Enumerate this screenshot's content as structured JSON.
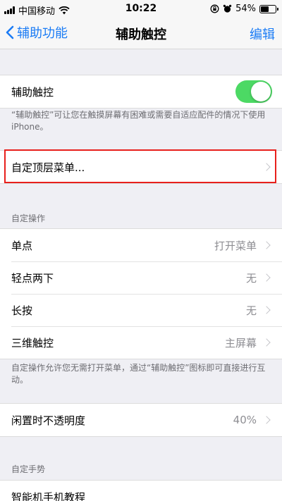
{
  "status_bar": {
    "carrier": "中国移动",
    "time": "10:22",
    "battery": "54%",
    "battery_level": 0.54
  },
  "nav": {
    "back_label": "辅助功能",
    "title": "辅助触控",
    "edit_label": "编辑"
  },
  "assistive_touch": {
    "label": "辅助触控",
    "enabled": true,
    "footnote": "“辅助触控”可让您在触摸屏幕有困难或需要自适应配件的情况下使用 iPhone。"
  },
  "top_menu": {
    "label": "自定顶层菜单..."
  },
  "custom_actions": {
    "header": "自定操作",
    "items": [
      {
        "label": "单点",
        "value": "打开菜单"
      },
      {
        "label": "轻点两下",
        "value": "无"
      },
      {
        "label": "长按",
        "value": "无"
      },
      {
        "label": "三维触控",
        "value": "主屏幕"
      }
    ],
    "footnote": "自定操作允许您无需打开菜单，通过“辅助触控”图标即可直接进行互动。"
  },
  "idle_opacity": {
    "label": "闲置时不透明度",
    "value": "40%"
  },
  "custom_gestures": {
    "header": "自定手势",
    "items": [
      {
        "label": "智能机手机教程"
      }
    ]
  },
  "colors": {
    "accent": "#1b7cf5",
    "toggle_on": "#4cd964",
    "highlight": "#e8201c",
    "background": "#efeff4"
  }
}
